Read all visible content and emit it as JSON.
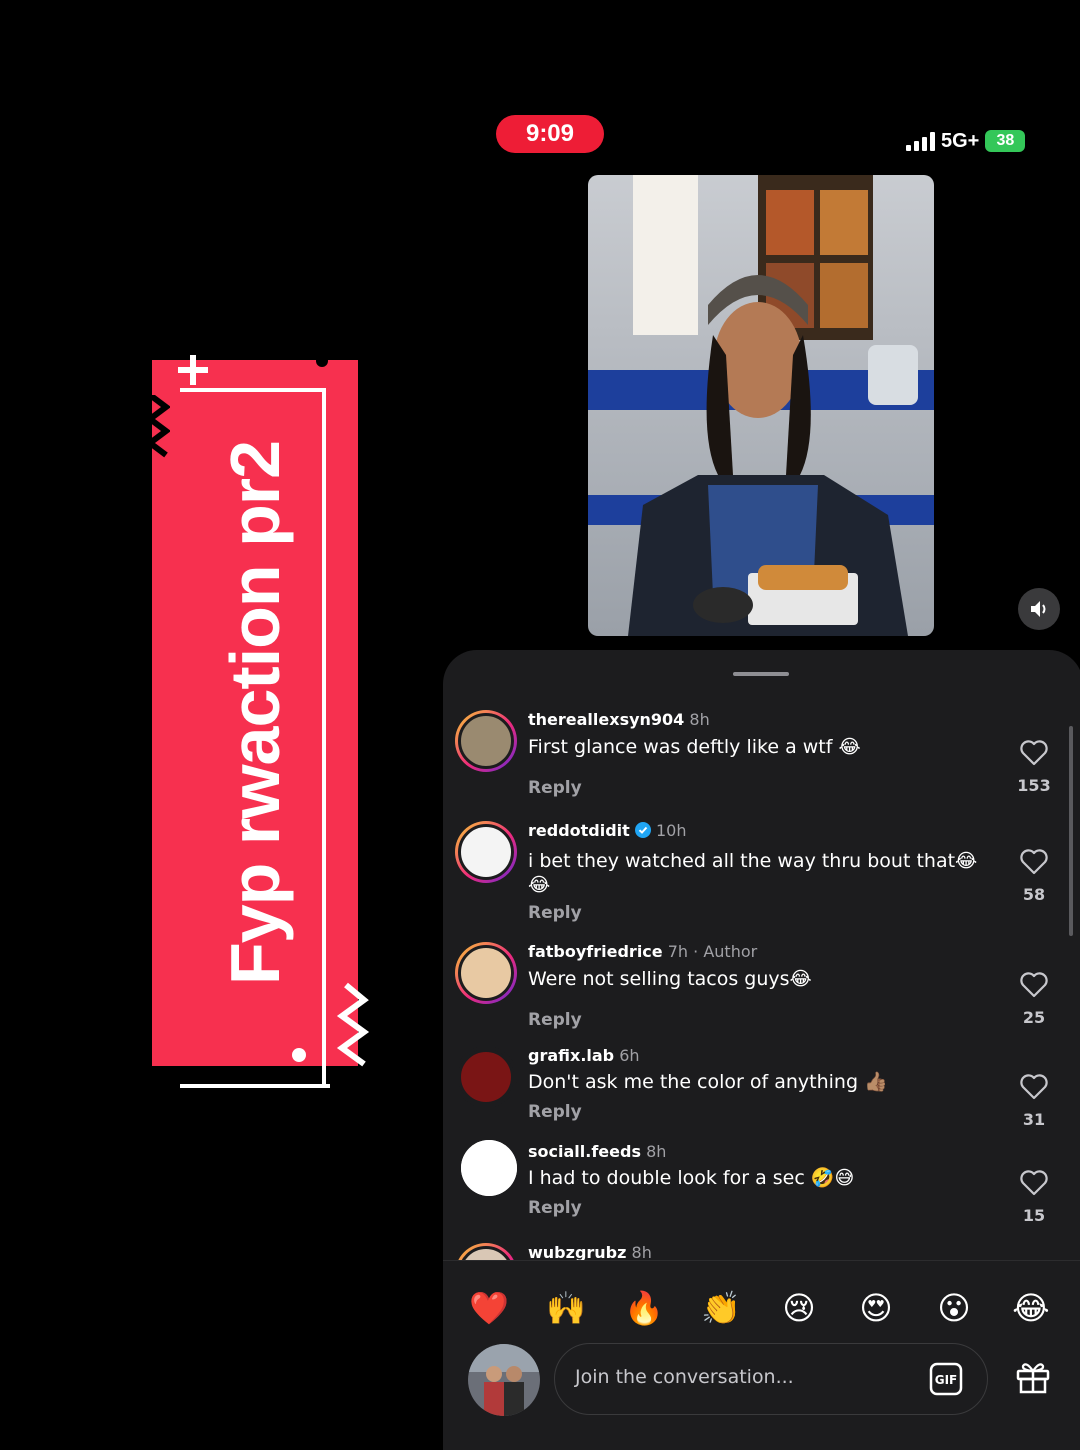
{
  "sticker": {
    "label": "Fyp rwaction pr2",
    "color": "#f7304f"
  },
  "status_bar": {
    "time": "9:09",
    "network": "5G+",
    "battery": "38"
  },
  "video": {
    "sound_icon": "speaker-icon"
  },
  "comments": [
    {
      "user": "thereallexsyn904",
      "age": "8h",
      "text": "First glance was deftly like a wtf 😂",
      "reply": "Reply",
      "likes": "153"
    },
    {
      "user": "reddotdidit",
      "verified": true,
      "age": "10h",
      "text": "i bet they watched all the way thru bout that😂😂",
      "reply": "Reply",
      "likes": "58"
    },
    {
      "user": "fatboyfriedrice",
      "age": "7h",
      "author_tag": "· Author",
      "text": "Were not selling tacos guys😂",
      "reply": "Reply",
      "likes": "25"
    },
    {
      "user": "grafix.lab",
      "age": "6h",
      "text": "Don't ask me the color of anything 👍🏽",
      "reply": "Reply",
      "likes": "31"
    },
    {
      "user": "sociall.feeds",
      "age": "8h",
      "text": "I had to double look for a sec 🤣😅",
      "reply": "Reply",
      "likes": "15"
    },
    {
      "user": "wubzgrubz",
      "age": "8h"
    }
  ],
  "reactions": [
    "❤️",
    "🙌",
    "🔥",
    "👏",
    "😢",
    "😍",
    "😮",
    "😂"
  ],
  "composer": {
    "placeholder": "Join the conversation...",
    "gif_label": "GIF"
  },
  "colors": {
    "sheet": "#1c1c1e",
    "accent": "#ee1d36",
    "battery": "#34c759"
  }
}
